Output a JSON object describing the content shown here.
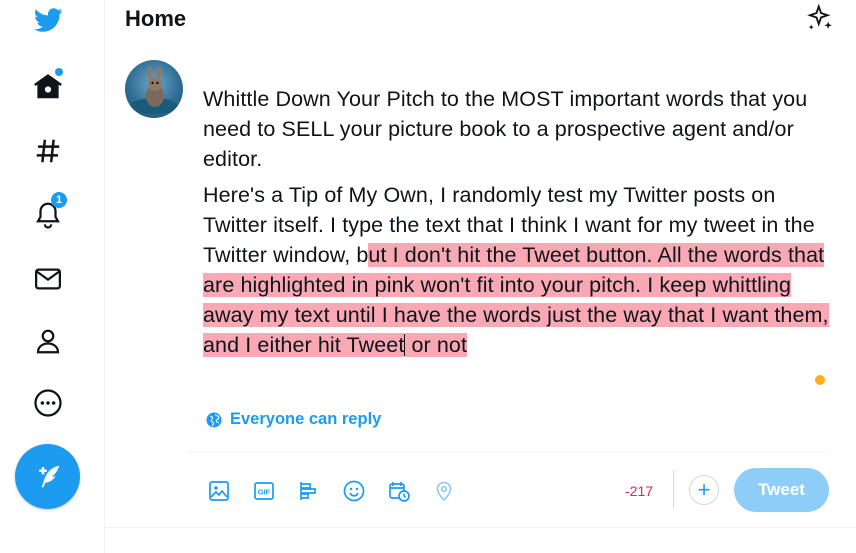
{
  "app": "Twitter",
  "colors": {
    "accent": "#1d9bf0",
    "highlight": "#f9a8b4",
    "over_limit": "#e0245e",
    "tweet_button_disabled": "#8ecdf7",
    "progress_ring": "#ffad1f"
  },
  "sidebar": {
    "logo_icon": "twitter-bird-icon",
    "items": [
      {
        "name": "home",
        "icon": "home-icon",
        "has_dot": true
      },
      {
        "name": "explore",
        "icon": "hashtag-icon"
      },
      {
        "name": "notifications",
        "icon": "bell-icon",
        "badge": "1"
      },
      {
        "name": "messages",
        "icon": "envelope-icon"
      },
      {
        "name": "profile",
        "icon": "person-icon"
      },
      {
        "name": "more",
        "icon": "more-circle-icon"
      }
    ],
    "compose_icon": "feather-plus-icon"
  },
  "header": {
    "title": "Home",
    "sparkle_icon": "top-tweets-sparkle-icon"
  },
  "composer": {
    "paragraph1": "Whittle Down Your Pitch to the MOST important words that you need to SELL your picture book to a prospective agent and/or editor.",
    "paragraph2_normal": "Here's a Tip of My Own, I randomly test my Twitter posts on Twitter itself. I type the text that I think I want for my tweet in the Twitter window, b",
    "paragraph2_highlighted_a": "ut I don't hit the Tweet button. All the words that are highlighted in pink won't fit into your pitch. I keep whittling away my  text until I have the words just the way that I want them, and I either hit Tweet",
    "paragraph2_highlighted_b": " or not",
    "reply_setting": "Everyone can reply",
    "toolbar_icons": [
      "media-icon",
      "gif-icon",
      "poll-icon",
      "emoji-icon",
      "schedule-icon",
      "location-icon"
    ],
    "char_remaining": "-217",
    "add_label": "+",
    "tweet_button": "Tweet"
  }
}
